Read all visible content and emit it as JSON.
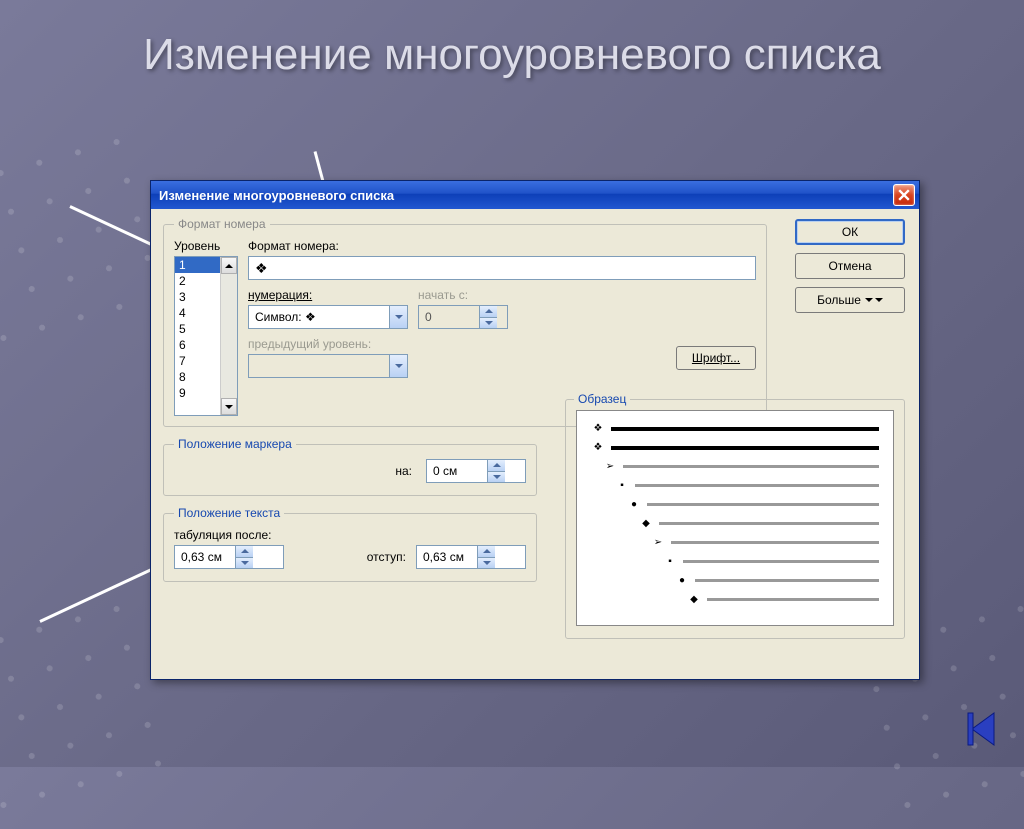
{
  "slide": {
    "title": "Изменение многоуровневого списка"
  },
  "dialog": {
    "title": "Изменение многоуровневого списка",
    "buttons": {
      "ok": "ОК",
      "cancel": "Отмена",
      "more": "Больше"
    },
    "groups": {
      "format": "Формат номера",
      "marker": "Положение маркера",
      "text": "Положение текста",
      "preview": "Образец"
    },
    "labels": {
      "level": "Уровень",
      "number_format": "Формат номера:",
      "numbering": "нумерация:",
      "start_at": "начать с:",
      "prev_level": "предыдущий уровень:",
      "font": "Шрифт...",
      "at": "на:",
      "tab_after": "табуляция после:",
      "indent": "отступ:"
    },
    "values": {
      "levels": [
        "1",
        "2",
        "3",
        "4",
        "5",
        "6",
        "7",
        "8",
        "9"
      ],
      "selected_level": "1",
      "number_format_value": "❖",
      "numbering_value": "Символ: ❖",
      "start_at_value": "0",
      "marker_at": "0 см",
      "tab_after": "0,63 см",
      "indent": "0,63 см"
    },
    "preview_bullets": [
      "❖",
      "❖",
      "➢",
      "▪",
      "●",
      "◆",
      "➢",
      "▪",
      "●",
      "◆"
    ]
  }
}
